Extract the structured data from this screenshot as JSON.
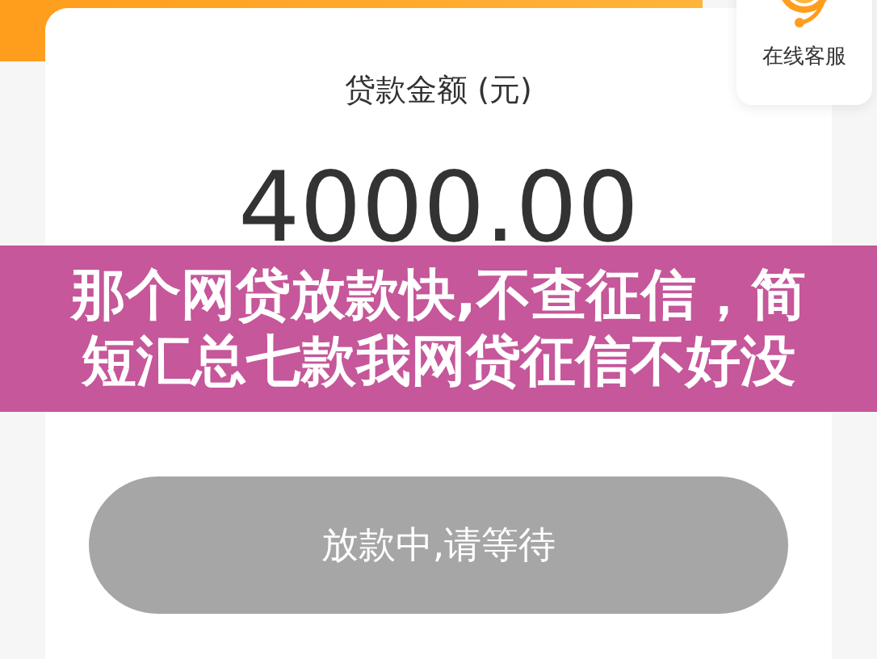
{
  "support": {
    "label": "在线客服"
  },
  "loan": {
    "label": "贷款金额 (元)",
    "amount": "4000.00"
  },
  "overlay_title": "那个网贷放款快,不查征信，简短汇总七款我网贷征信不好没",
  "status_button": {
    "label": "放款中,请等待",
    "disabled": true
  }
}
